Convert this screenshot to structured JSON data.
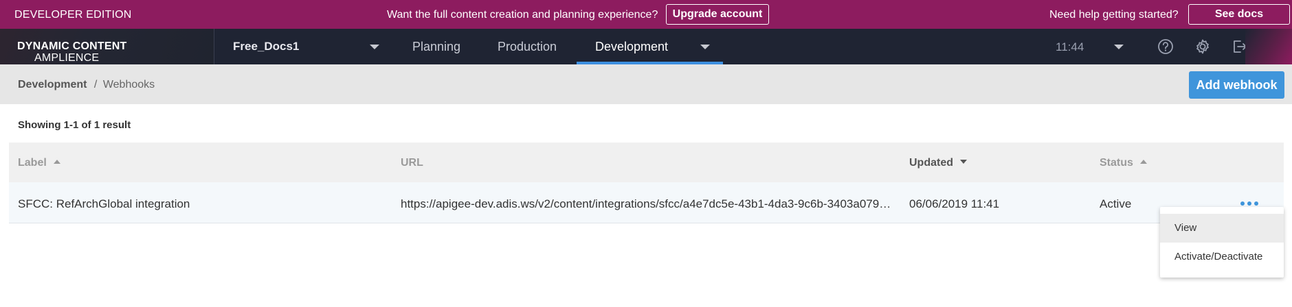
{
  "promo": {
    "edition": "DEVELOPER EDITION",
    "message": "Want the full content creation and planning experience?",
    "upgrade_label": "Upgrade account",
    "help_text": "Need help getting started?",
    "docs_label": "See docs",
    "color": "#8d1c5f"
  },
  "nav": {
    "brand_light": "AMPLIENCE ",
    "brand_bold": "DYNAMIC CONTENT",
    "hub": "Free_Docs1",
    "tabs": [
      "Planning",
      "Production",
      "Development"
    ],
    "active_tab": "Development",
    "time": "11:44",
    "icons": [
      "chevron-down-icon",
      "help-icon",
      "gear-icon",
      "logout-icon"
    ],
    "accent": "#3d8fe0"
  },
  "breadcrumb": {
    "root": "Development",
    "separator": "/",
    "current": "Webhooks"
  },
  "add_label": "Add webhook",
  "result_count": "Showing 1-1 of 1 result",
  "table": {
    "headers": {
      "label": "Label",
      "url": "URL",
      "updated": "Updated",
      "status": "Status"
    },
    "rows": [
      {
        "label": "SFCC: RefArchGlobal integration",
        "url": "https://apigee-dev.adis.ws/v2/content/integrations/sfcc/a4e7dc5e-43b1-4da3-9c6b-3403a079…",
        "updated": "06/06/2019 11:41",
        "status": "Active"
      }
    ]
  },
  "menu": {
    "items": [
      "View",
      "Activate/Deactivate"
    ]
  }
}
